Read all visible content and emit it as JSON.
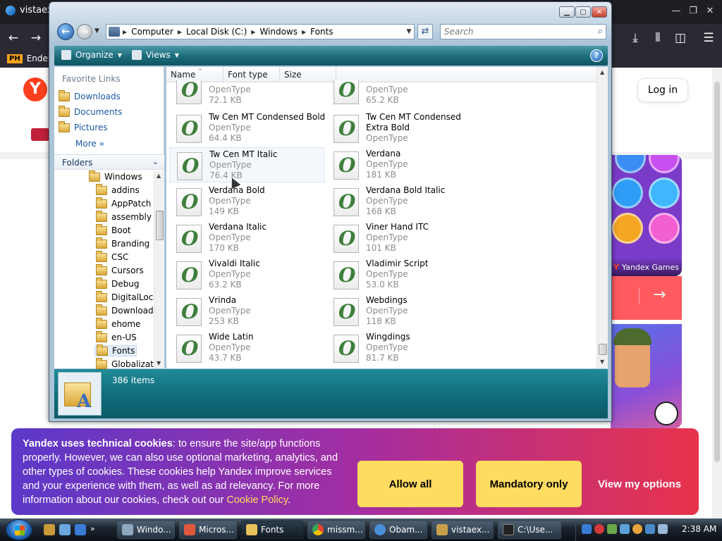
{
  "browser": {
    "tab_title": "vistaexl",
    "bookmark_badge": "PH",
    "bookmark_label": "Enderm"
  },
  "yandex": {
    "logo": "Y",
    "login_label": "Log in",
    "games_label": "Yandex Games",
    "games_logo": "Y",
    "next_arrow": "→"
  },
  "cookie": {
    "title": "Yandex uses technical cookies",
    "body": ": to ensure the site/app functions properly. However, we can also use optional marketing, analytics, and other types of cookies. These cookies help Yandex improve services and your experience with them, as well as ad relevancy. For more information about our cookies, check out our ",
    "link": "Cookie Policy",
    "tail": ".",
    "allow_all": "Allow all",
    "mandatory_only": "Mandatory only",
    "view_options": "View my options"
  },
  "explorer": {
    "address": {
      "segments": [
        "Computer",
        "Local Disk (C:)",
        "Windows",
        "Fonts"
      ]
    },
    "search_placeholder": "Search",
    "toolbar": {
      "organize": "Organize",
      "views": "Views"
    },
    "nav": {
      "favorites_header": "Favorite Links",
      "favorites": [
        "Downloads",
        "Documents",
        "Pictures"
      ],
      "more": "More",
      "folders_header": "Folders",
      "tree": [
        "Windows",
        "addins",
        "AppPatch",
        "assembly",
        "Boot",
        "Branding",
        "CSC",
        "Cursors",
        "Debug",
        "DigitalLock",
        "Downloaded",
        "ehome",
        "en-US",
        "Fonts",
        "Globalizatio"
      ]
    },
    "columns": {
      "name": "Name",
      "type": "Font type",
      "size": "Size"
    },
    "files": [
      {
        "name": "",
        "type": "OpenType",
        "size": "72.1 KB"
      },
      {
        "name": "",
        "type": "OpenType",
        "size": "65.2 KB"
      },
      {
        "name": "Tw Cen MT Condensed Bold",
        "type": "OpenType",
        "size": "64.4 KB"
      },
      {
        "name": "Tw Cen MT Condensed Extra Bold",
        "type": "OpenType",
        "size": ""
      },
      {
        "name": "Tw Cen MT Italic",
        "type": "OpenType",
        "size": "76.4 KB"
      },
      {
        "name": "Verdana",
        "type": "OpenType",
        "size": "181 KB"
      },
      {
        "name": "Verdana Bold",
        "type": "OpenType",
        "size": "149 KB"
      },
      {
        "name": "Verdana Bold Italic",
        "type": "OpenType",
        "size": "168 KB"
      },
      {
        "name": "Verdana Italic",
        "type": "OpenType",
        "size": "170 KB"
      },
      {
        "name": "Viner Hand ITC",
        "type": "OpenType",
        "size": "101 KB"
      },
      {
        "name": "Vivaldi Italic",
        "type": "OpenType",
        "size": "63.2 KB"
      },
      {
        "name": "Vladimir Script",
        "type": "OpenType",
        "size": "53.0 KB"
      },
      {
        "name": "Vrinda",
        "type": "OpenType",
        "size": "253 KB"
      },
      {
        "name": "Webdings",
        "type": "OpenType",
        "size": "118 KB"
      },
      {
        "name": "Wide Latin",
        "type": "OpenType",
        "size": "43.7 KB"
      },
      {
        "name": "Wingdings",
        "type": "OpenType",
        "size": "81.7 KB"
      }
    ],
    "item_count": "386 items"
  },
  "taskbar": {
    "buttons": [
      "Windo...",
      "Micros...",
      "Fonts",
      "missm...",
      "Obam...",
      "vistaex...",
      "C:\\Use..."
    ],
    "clock": "2:38 AM"
  },
  "colors": {
    "command_bar": "#1f6f7e",
    "cookie_button": "#ffdc60",
    "yandex_red": "#fc3f1d"
  }
}
